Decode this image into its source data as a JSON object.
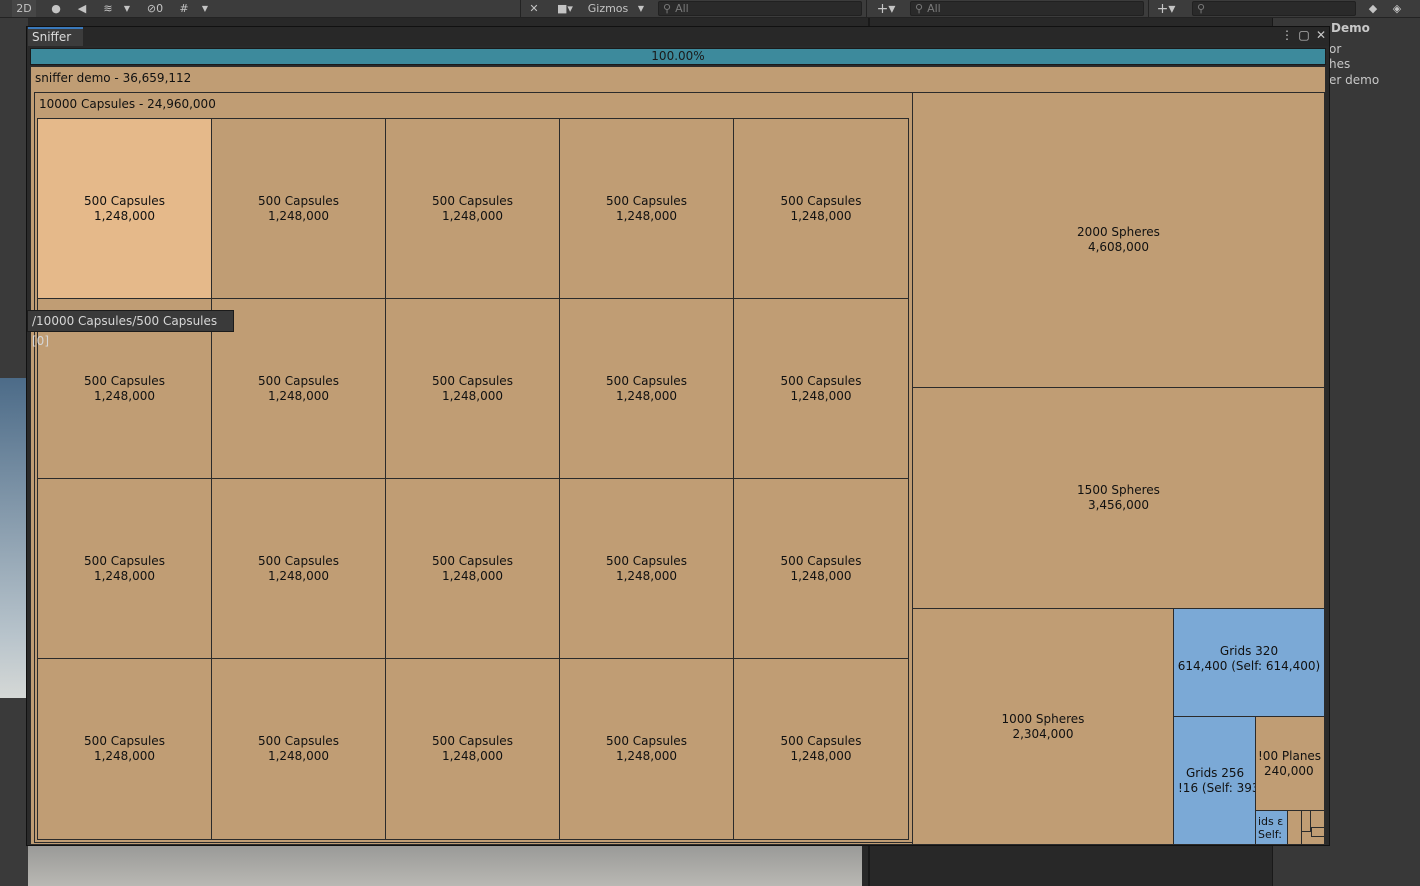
{
  "toolbar": {
    "mode_2d": "2D",
    "hidden_count": "0",
    "gizmos_label": "Gizmos",
    "scene_search_placeholder": "All",
    "hierarchy_search_placeholder": "All"
  },
  "hierarchy": {
    "title": "Demo",
    "items": [
      "or",
      "hes",
      "er demo"
    ]
  },
  "sniffer": {
    "tab_title": "Sniffer",
    "progress_label": "100.00%",
    "root_label": "sniffer demo - 36,659,112",
    "capsules_group_label": "10000 Capsules - 24,960,000",
    "capsule_cells": [
      {
        "name": "500 Capsules",
        "value": "1,248,000"
      },
      {
        "name": "500 Capsules",
        "value": "1,248,000"
      },
      {
        "name": "500 Capsules",
        "value": "1,248,000"
      },
      {
        "name": "500 Capsules",
        "value": "1,248,000"
      },
      {
        "name": "500 Capsules",
        "value": "1,248,000"
      },
      {
        "name": "500 Capsules",
        "value": "1,248,000"
      },
      {
        "name": "500 Capsules",
        "value": "1,248,000"
      },
      {
        "name": "500 Capsules",
        "value": "1,248,000"
      },
      {
        "name": "500 Capsules",
        "value": "1,248,000"
      },
      {
        "name": "500 Capsules",
        "value": "1,248,000"
      },
      {
        "name": "500 Capsules",
        "value": "1,248,000"
      },
      {
        "name": "500 Capsules",
        "value": "1,248,000"
      },
      {
        "name": "500 Capsules",
        "value": "1,248,000"
      },
      {
        "name": "500 Capsules",
        "value": "1,248,000"
      },
      {
        "name": "500 Capsules",
        "value": "1,248,000"
      },
      {
        "name": "500 Capsules",
        "value": "1,248,000"
      },
      {
        "name": "500 Capsules",
        "value": "1,248,000"
      },
      {
        "name": "500 Capsules",
        "value": "1,248,000"
      },
      {
        "name": "500 Capsules",
        "value": "1,248,000"
      },
      {
        "name": "500 Capsules",
        "value": "1,248,000"
      }
    ],
    "spheres_2000": {
      "name": "2000 Spheres",
      "value": "4,608,000"
    },
    "spheres_1500": {
      "name": "1500 Spheres",
      "value": "3,456,000"
    },
    "spheres_1000": {
      "name": "1000 Spheres",
      "value": "2,304,000"
    },
    "grids_320": {
      "name": "Grids 320",
      "value": "614,400 (Self: 614,400)"
    },
    "grids_256": {
      "name": "Grids 256",
      "value": "!16 (Self: 393"
    },
    "planes": {
      "name": "!00 Planes",
      "value": "240,000"
    },
    "grids_small": {
      "name": "ids ε",
      "value": "Self:"
    },
    "tooltip": "/10000 Capsules/500 Capsules [0]"
  },
  "colors": {
    "cell_default": "#c09d74",
    "cell_highlight": "#e5b98a",
    "cell_grid": "#7ba9d6",
    "progress": "#3d8a9c"
  }
}
